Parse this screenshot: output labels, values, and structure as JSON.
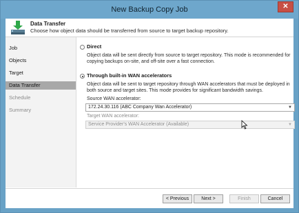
{
  "window": {
    "title": "New Backup Copy Job",
    "close_glyph": "✕",
    "close_color": "#c74f45",
    "titlebar_color": "#6ea7cc"
  },
  "header": {
    "title": "Data Transfer",
    "subtitle": "Choose how object data should be transferred from source to target backup repository.",
    "icon": "download-to-storage-icon"
  },
  "nav": {
    "items": [
      {
        "label": "Job",
        "state": "normal"
      },
      {
        "label": "Objects",
        "state": "normal"
      },
      {
        "label": "Target",
        "state": "normal"
      },
      {
        "label": "Data Transfer",
        "state": "selected"
      },
      {
        "label": "Schedule",
        "state": "disabled"
      },
      {
        "label": "Summary",
        "state": "disabled"
      }
    ]
  },
  "options": {
    "direct": {
      "label": "Direct",
      "selected": false,
      "description_line1": "Object data will be sent directly from source to target repository. This mode is recommended for",
      "description_line2": "copying backups on-site, and off-site over a fast connection."
    },
    "wan": {
      "label": "Through built-in WAN accelerators",
      "selected": true,
      "description_line1": "Object data will be sent to target repository through WAN accelerators that must be deployed in",
      "description_line2": "both source and target sites. This mode provides for significant bandwidth savings."
    }
  },
  "source_wan": {
    "label": "Source WAN accelerator:",
    "value": "172.24.30.116 (ABC Company Wan Accelerator)"
  },
  "target_wan": {
    "label": "Target WAN accelerator:",
    "value": "Service Provider's WAN Accelerator (Available)",
    "enabled": false
  },
  "buttons": {
    "previous": "< Previous",
    "next": "Next >",
    "finish": "Finish",
    "cancel": "Cancel"
  },
  "glyphs": {
    "dropdown_arrow": "▼"
  }
}
